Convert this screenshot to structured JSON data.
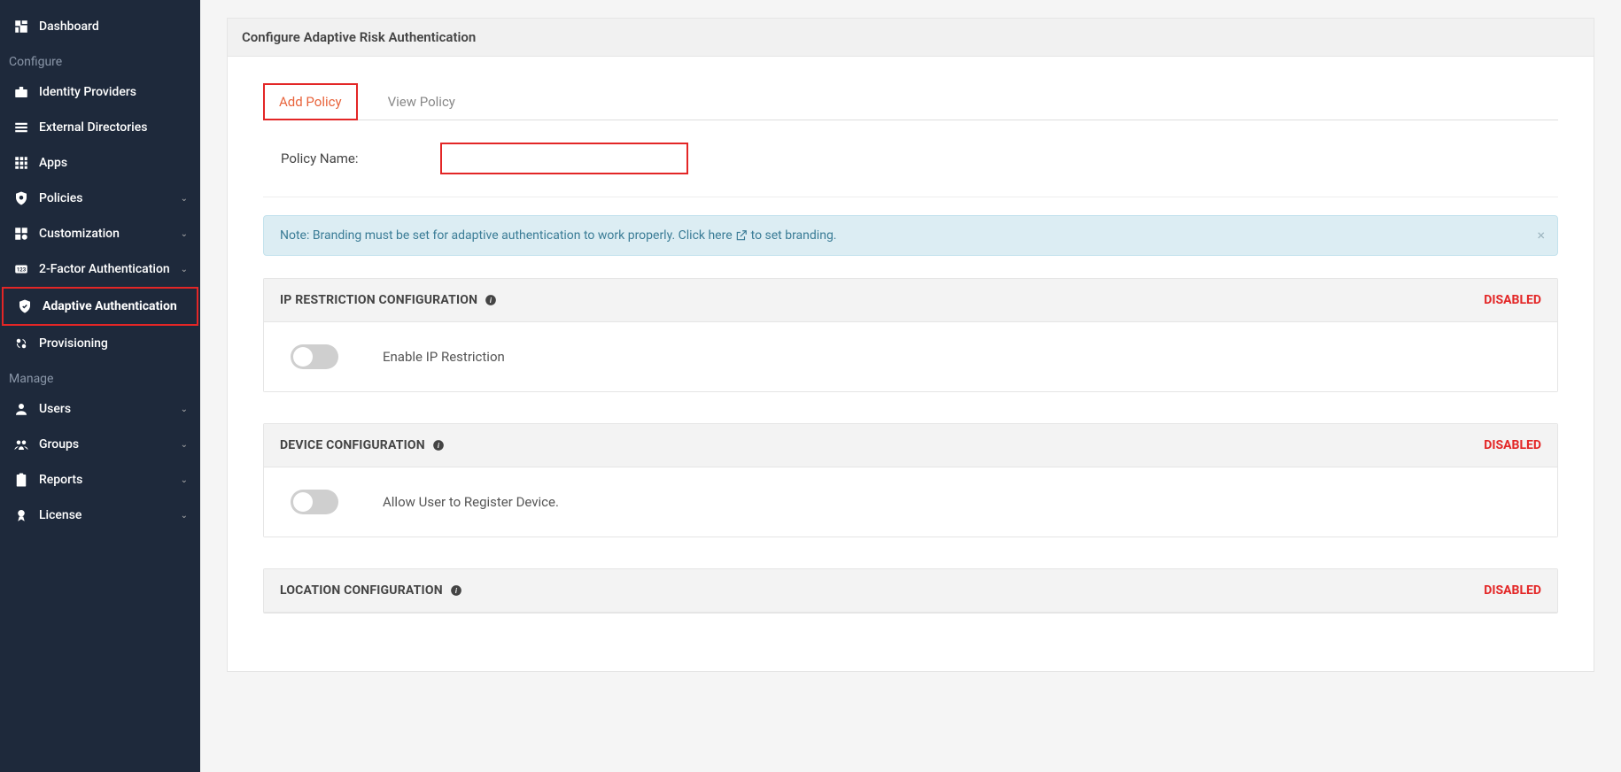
{
  "sidebar": {
    "sections": {
      "configure": "Configure",
      "manage": "Manage"
    },
    "items": {
      "dashboard": "Dashboard",
      "identity_providers": "Identity Providers",
      "external_directories": "External Directories",
      "apps": "Apps",
      "policies": "Policies",
      "customization": "Customization",
      "two_factor": "2-Factor Authentication",
      "adaptive_auth": "Adaptive Authentication",
      "provisioning": "Provisioning",
      "users": "Users",
      "groups": "Groups",
      "reports": "Reports",
      "license": "License"
    }
  },
  "page": {
    "title": "Configure Adaptive Risk Authentication"
  },
  "tabs": {
    "add_policy": "Add Policy",
    "view_policy": "View Policy"
  },
  "form": {
    "policy_name_label": "Policy Name:",
    "policy_name_value": ""
  },
  "alert": {
    "text_prefix": "Note: Branding must be set for adaptive authentication to work properly. Click ",
    "link_text": "here",
    "text_suffix": " to set branding."
  },
  "cards": {
    "ip": {
      "title": "IP RESTRICTION CONFIGURATION",
      "status": "DISABLED",
      "toggle_label": "Enable IP Restriction"
    },
    "device": {
      "title": "DEVICE CONFIGURATION",
      "status": "DISABLED",
      "toggle_label": "Allow User to Register Device."
    },
    "location": {
      "title": "LOCATION CONFIGURATION",
      "status": "DISABLED"
    }
  }
}
